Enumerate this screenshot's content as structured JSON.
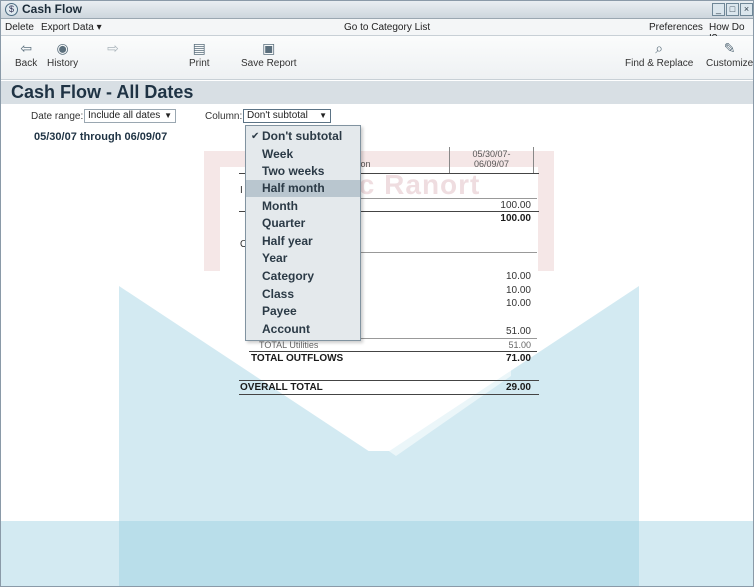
{
  "window": {
    "title": "Cash Flow",
    "buttons": [
      "_",
      "□",
      "×"
    ]
  },
  "menubar": {
    "delete": "Delete",
    "export": "Export Data ▾",
    "goto": "Go to Category List",
    "preferences": "Preferences",
    "howdoi": "How Do I?"
  },
  "toolbar": {
    "back": "Back",
    "history": "History",
    "forward": "",
    "print": "Print",
    "save_report": "Save Report",
    "find_replace": "Find & Replace",
    "customize": "Customize"
  },
  "report": {
    "title": "Cash Flow - All Dates",
    "date_range_label": "Date range:",
    "date_range_value": "Include all dates",
    "column_label": "Column:",
    "column_value": "Don't subtotal",
    "period": "05/30/07 through 06/09/07",
    "col_header_date": "05/30/07-\n06/09/07",
    "col_header_desc": "iption",
    "rows": {
      "inflow_val": "100.00",
      "inflow_total": "100.00",
      "util1": "10.00",
      "util2": "10.00",
      "util3": "10.00",
      "util4": "51.00",
      "total_utilities_label": "TOTAL Utilities",
      "total_utilities_val": "51.00",
      "total_outflows_label": "TOTAL OUTFLOWS",
      "total_outflows_val": "71.00",
      "overall_label": "OVERALL TOTAL",
      "overall_val": "29.00"
    }
  },
  "dropdown": {
    "items": [
      "Don't subtotal",
      "Week",
      "Two weeks",
      "Half month",
      "Month",
      "Quarter",
      "Half year",
      "Year",
      "Category",
      "Class",
      "Payee",
      "Account"
    ],
    "checked_index": 0,
    "highlighted_index": 3
  }
}
